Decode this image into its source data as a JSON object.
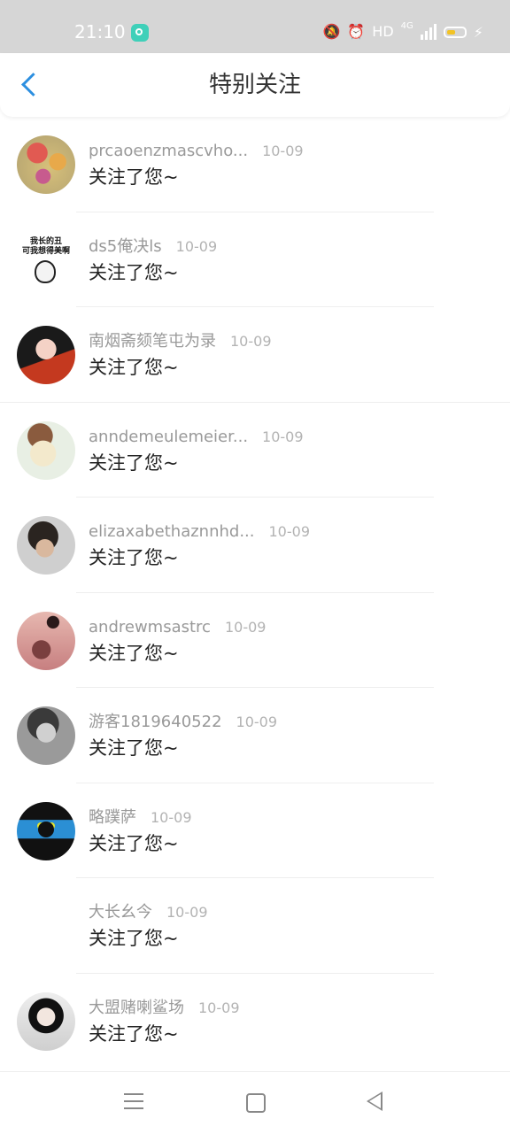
{
  "status_bar": {
    "time": "21:10",
    "app_notification_icon": "chat-bubble-icon",
    "right_icons": [
      "mute-vibrate-icon",
      "alarm-icon",
      "hd-icon",
      "signal-4g-icon",
      "battery-icon",
      "charging-icon"
    ],
    "hd_label": "HD",
    "network_label": "4G"
  },
  "header": {
    "back_icon": "chevron-left-icon",
    "title": "特别关注"
  },
  "items": [
    {
      "username": "prcaoenzmascvho...",
      "time": "10-09",
      "message": "关注了您~"
    },
    {
      "username": "ds5俺决ls",
      "time": "10-09",
      "message": "关注了您~",
      "avatar_text": "我长的丑\n可我想得美啊"
    },
    {
      "username": "南烟斋颏笔屯为录",
      "time": "10-09",
      "message": "关注了您~"
    },
    {
      "username": "anndemeulemeier...",
      "time": "10-09",
      "message": "关注了您~"
    },
    {
      "username": "elizaxabethaznnhd...",
      "time": "10-09",
      "message": "关注了您~"
    },
    {
      "username": "andrewmsastrc",
      "time": "10-09",
      "message": "关注了您~"
    },
    {
      "username": "游客1819640522",
      "time": "10-09",
      "message": "关注了您~"
    },
    {
      "username": "略蹼萨",
      "time": "10-09",
      "message": "关注了您~"
    },
    {
      "username": "大长幺今",
      "time": "10-09",
      "message": "关注了您~"
    },
    {
      "username": "大盟赌喇鲨场",
      "time": "10-09",
      "message": "关注了您~"
    }
  ],
  "nav_bar": {
    "icons": [
      "menu-icon",
      "home-icon",
      "back-triangle-icon"
    ]
  },
  "colors": {
    "accent": "#2c8fe0",
    "status_bar_bg": "#d6d6d6",
    "username": "#999999",
    "message": "#222222"
  }
}
